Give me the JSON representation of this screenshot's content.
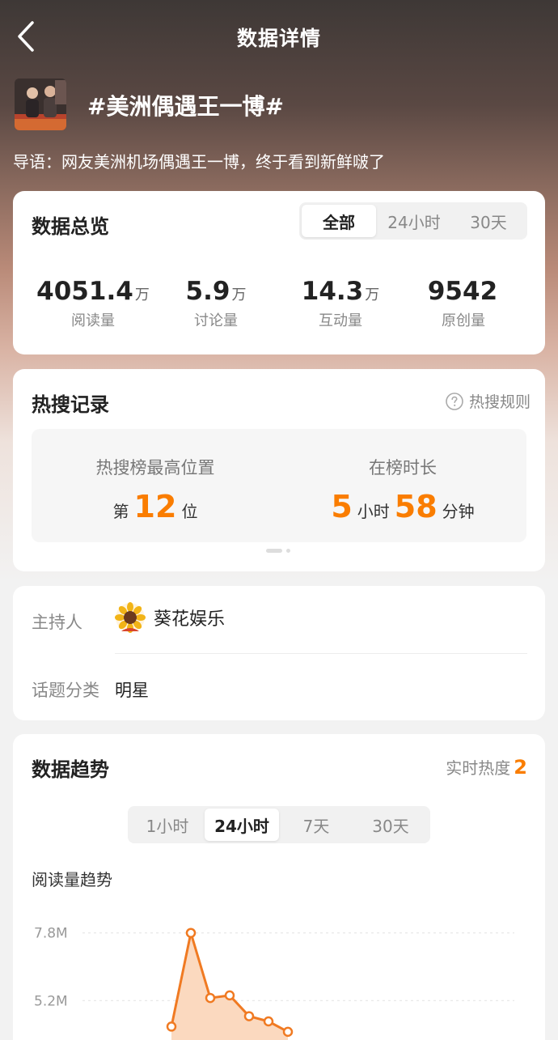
{
  "header": {
    "title": "数据详情"
  },
  "topic": {
    "title": "#美洲偶遇王一博#",
    "intro": "导语：网友美洲机场偶遇王一博，终于看到新鲜啵了"
  },
  "overview": {
    "title": "数据总览",
    "tabs": [
      "全部",
      "24小时",
      "30天"
    ],
    "stats": [
      {
        "value": "4051.4",
        "unit": "万",
        "label": "阅读量"
      },
      {
        "value": "5.9",
        "unit": "万",
        "label": "讨论量"
      },
      {
        "value": "14.3",
        "unit": "万",
        "label": "互动量"
      },
      {
        "value": "9542",
        "unit": "",
        "label": "原创量"
      }
    ]
  },
  "hot_search": {
    "title": "热搜记录",
    "rules_label": "热搜规则",
    "highest_label": "热搜榜最高位置",
    "rank_prefix": "第",
    "rank_value": "12",
    "rank_suffix": "位",
    "duration_label": "在榜时长",
    "hours": "5",
    "hours_unit": "小时",
    "minutes": "58",
    "minutes_unit": "分钟"
  },
  "info": {
    "host_label": "主持人",
    "host_name": "葵花娱乐",
    "category_label": "话题分类",
    "category_value": "明星"
  },
  "trend": {
    "title": "数据趋势",
    "realtime_label": "实时热度",
    "realtime_value": "2",
    "tabs": [
      "1小时",
      "24小时",
      "7天",
      "30天"
    ],
    "chart_title": "阅读量趋势"
  },
  "colors": {
    "accent": "#fa7d00",
    "chart_line": "#f07a22",
    "chart_fill": "#fbd9bf"
  },
  "chart_data": {
    "type": "area",
    "title": "阅读量趋势",
    "y_tick_labels": [
      "7.8M",
      "5.2M"
    ],
    "y_ticks": [
      7.8,
      5.2
    ],
    "ylim": [
      3.0,
      8.6
    ],
    "y_unit": "M",
    "series": [
      {
        "values": [
          4.2,
          7.8,
          5.3,
          5.4,
          4.6,
          4.4,
          4.0
        ]
      }
    ],
    "grid": true,
    "legend": "none"
  }
}
